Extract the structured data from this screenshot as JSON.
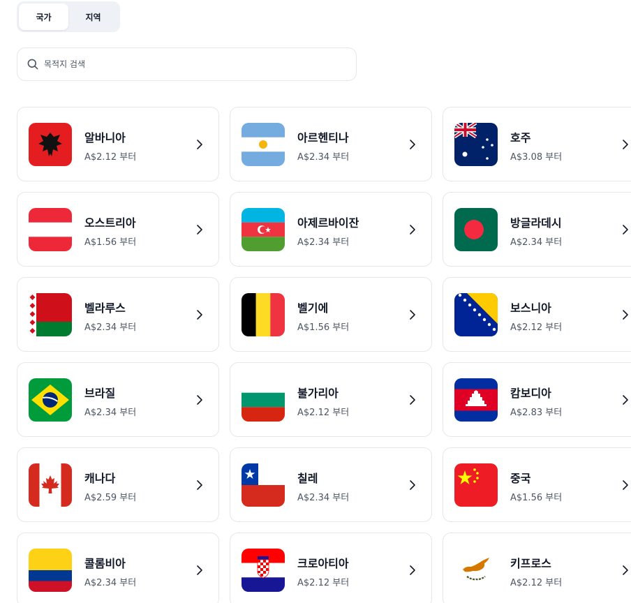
{
  "tabs": [
    {
      "label": "국가",
      "active": true
    },
    {
      "label": "지역",
      "active": false
    }
  ],
  "search": {
    "placeholder": "목적지 검색",
    "value": ""
  },
  "countries": [
    {
      "name": "알바니아",
      "price": "A$2.12 부터",
      "flag": "albania-flag"
    },
    {
      "name": "아르헨티나",
      "price": "A$2.34 부터",
      "flag": "argentina-flag"
    },
    {
      "name": "호주",
      "price": "A$3.08 부터",
      "flag": "australia-flag"
    },
    {
      "name": "오스트리아",
      "price": "A$1.56 부터",
      "flag": "austria-flag"
    },
    {
      "name": "아제르바이잔",
      "price": "A$2.34 부터",
      "flag": "azerbaijan-flag"
    },
    {
      "name": "방글라데시",
      "price": "A$2.34 부터",
      "flag": "bangladesh-flag"
    },
    {
      "name": "벨라루스",
      "price": "A$2.34 부터",
      "flag": "belarus-flag"
    },
    {
      "name": "벨기에",
      "price": "A$1.56 부터",
      "flag": "belgium-flag"
    },
    {
      "name": "보스니아",
      "price": "A$2.12 부터",
      "flag": "bosnia-flag"
    },
    {
      "name": "브라질",
      "price": "A$2.34 부터",
      "flag": "brazil-flag"
    },
    {
      "name": "불가리아",
      "price": "A$2.12 부터",
      "flag": "bulgaria-flag"
    },
    {
      "name": "캄보디아",
      "price": "A$2.83 부터",
      "flag": "cambodia-flag"
    },
    {
      "name": "캐나다",
      "price": "A$2.59 부터",
      "flag": "canada-flag"
    },
    {
      "name": "칠레",
      "price": "A$2.34 부터",
      "flag": "chile-flag"
    },
    {
      "name": "중국",
      "price": "A$1.56 부터",
      "flag": "china-flag"
    },
    {
      "name": "콜롬비아",
      "price": "A$2.34 부터",
      "flag": "colombia-flag"
    },
    {
      "name": "크로아티아",
      "price": "A$2.12 부터",
      "flag": "croatia-flag"
    },
    {
      "name": "키프로스",
      "price": "A$2.12 부터",
      "flag": "cyprus-flag"
    }
  ]
}
